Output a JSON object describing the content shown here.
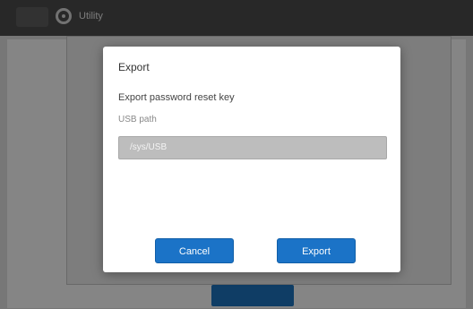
{
  "app": {
    "title": "Utility"
  },
  "dialog": {
    "title": "Export",
    "description": "Export password reset key",
    "field_label": "USB path",
    "field_value": "/sys/USB",
    "cancel_label": "Cancel",
    "export_label": "Export"
  },
  "icons": [
    "gear-icon"
  ],
  "colors": {
    "primary": "#1b73c7",
    "overlay": "rgba(0,0,0,0.45)"
  }
}
